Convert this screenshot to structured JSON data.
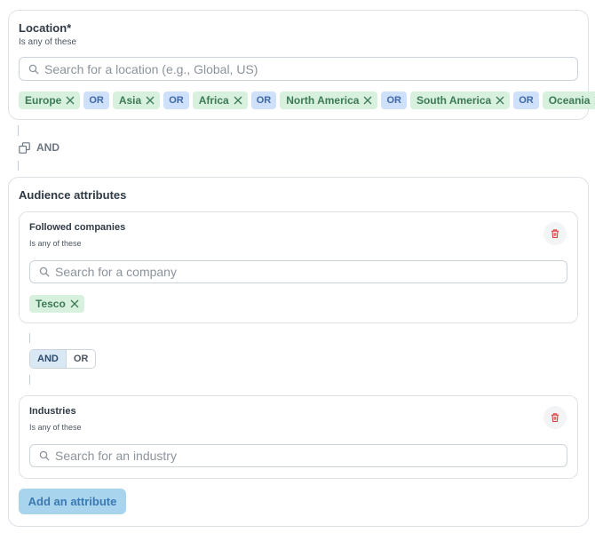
{
  "location": {
    "title": "Location*",
    "subtitle": "Is any of these",
    "search_placeholder": "Search for a location (e.g., Global, US)",
    "chips": [
      "Europe",
      "Asia",
      "Africa",
      "North America",
      "South America",
      "Oceania"
    ],
    "separator": "OR"
  },
  "connector": {
    "label": "AND"
  },
  "audience": {
    "title": "Audience attributes",
    "followed": {
      "title": "Followed companies",
      "subtitle": "Is any of these",
      "search_placeholder": "Search for a company",
      "chips": [
        "Tesco"
      ]
    },
    "toggle": {
      "and": "AND",
      "or": "OR"
    },
    "industries": {
      "title": "Industries",
      "subtitle": "Is any of these",
      "search_placeholder": "Search for an industry"
    },
    "add_button": "Add an attribute"
  },
  "colors": {
    "chip_bg": "#d8f0de",
    "chip_text": "#3d7a56",
    "or_bg": "#cfe0fb",
    "or_text": "#3f68a8",
    "add_button_bg": "#a8d4ee",
    "trash_icon": "#d9413d"
  }
}
